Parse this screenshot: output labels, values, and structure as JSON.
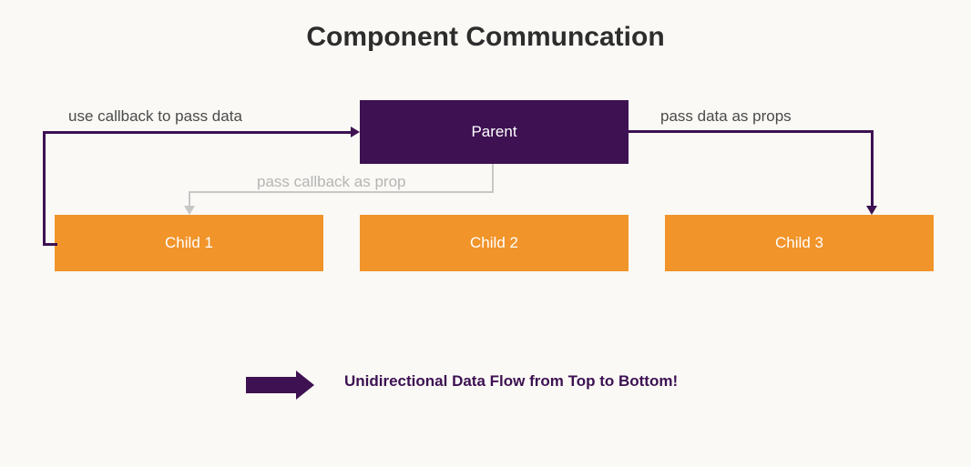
{
  "title": "Component Communcation",
  "nodes": {
    "parent": "Parent",
    "child1": "Child 1",
    "child2": "Child 2",
    "child3": "Child 3"
  },
  "labels": {
    "callback_up": "use callback to pass data",
    "props": "pass data as props",
    "callback_prop": "pass callback as prop"
  },
  "legend": {
    "text": "Unidirectional Data Flow from Top to Bottom!"
  },
  "colors": {
    "parent_bg": "#3d1152",
    "child_bg": "#f1942a",
    "arrow_primary": "#3d1152",
    "arrow_secondary": "#c7c7c7",
    "legend_text": "#3d1152"
  }
}
